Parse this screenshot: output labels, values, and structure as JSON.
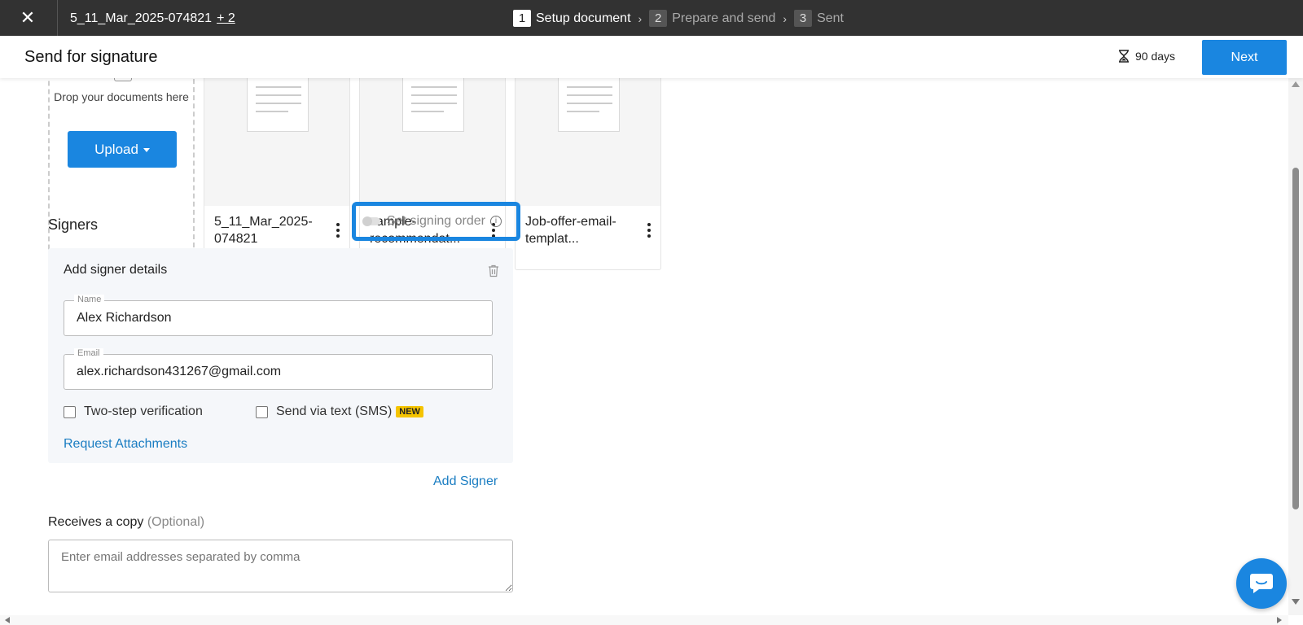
{
  "topbar": {
    "close_icon": "close-icon",
    "document_name": "5_11_Mar_2025-074821",
    "more_documents": "+ 2",
    "steps": [
      {
        "number": "1",
        "label": "Setup document",
        "active": true
      },
      {
        "number": "2",
        "label": "Prepare and send",
        "active": false
      },
      {
        "number": "3",
        "label": "Sent",
        "active": false
      }
    ]
  },
  "header": {
    "title": "Send for signature",
    "expiry_icon": "hourglass-icon",
    "expiry": "90 days",
    "next_label": "Next"
  },
  "upload": {
    "drop_text": "Drop your documents here",
    "upload_label": "Upload"
  },
  "documents": [
    {
      "name": "5_11_Mar_2025-074821"
    },
    {
      "name": "sample-recommendat..."
    },
    {
      "name": "Job-offer-email-templat..."
    }
  ],
  "signers": {
    "title": "Signers",
    "signing_order_label": "Set signing order",
    "panel_title": "Add signer details",
    "name_label": "Name",
    "name_value": "Alex Richardson",
    "email_label": "Email",
    "email_value": "alex.richardson431267@gmail.com",
    "two_step_label": "Two-step verification",
    "sms_label": "Send via text (SMS)",
    "new_badge": "NEW",
    "request_attachments": "Request Attachments",
    "add_signer": "Add Signer"
  },
  "copy": {
    "title": "Receives a copy",
    "optional": "(Optional)",
    "placeholder": "Enter email addresses separated by comma"
  },
  "colors": {
    "topbar": "#323232",
    "primary": "#1a86e0",
    "link": "#1a7dc2",
    "badge": "#f5c400"
  }
}
